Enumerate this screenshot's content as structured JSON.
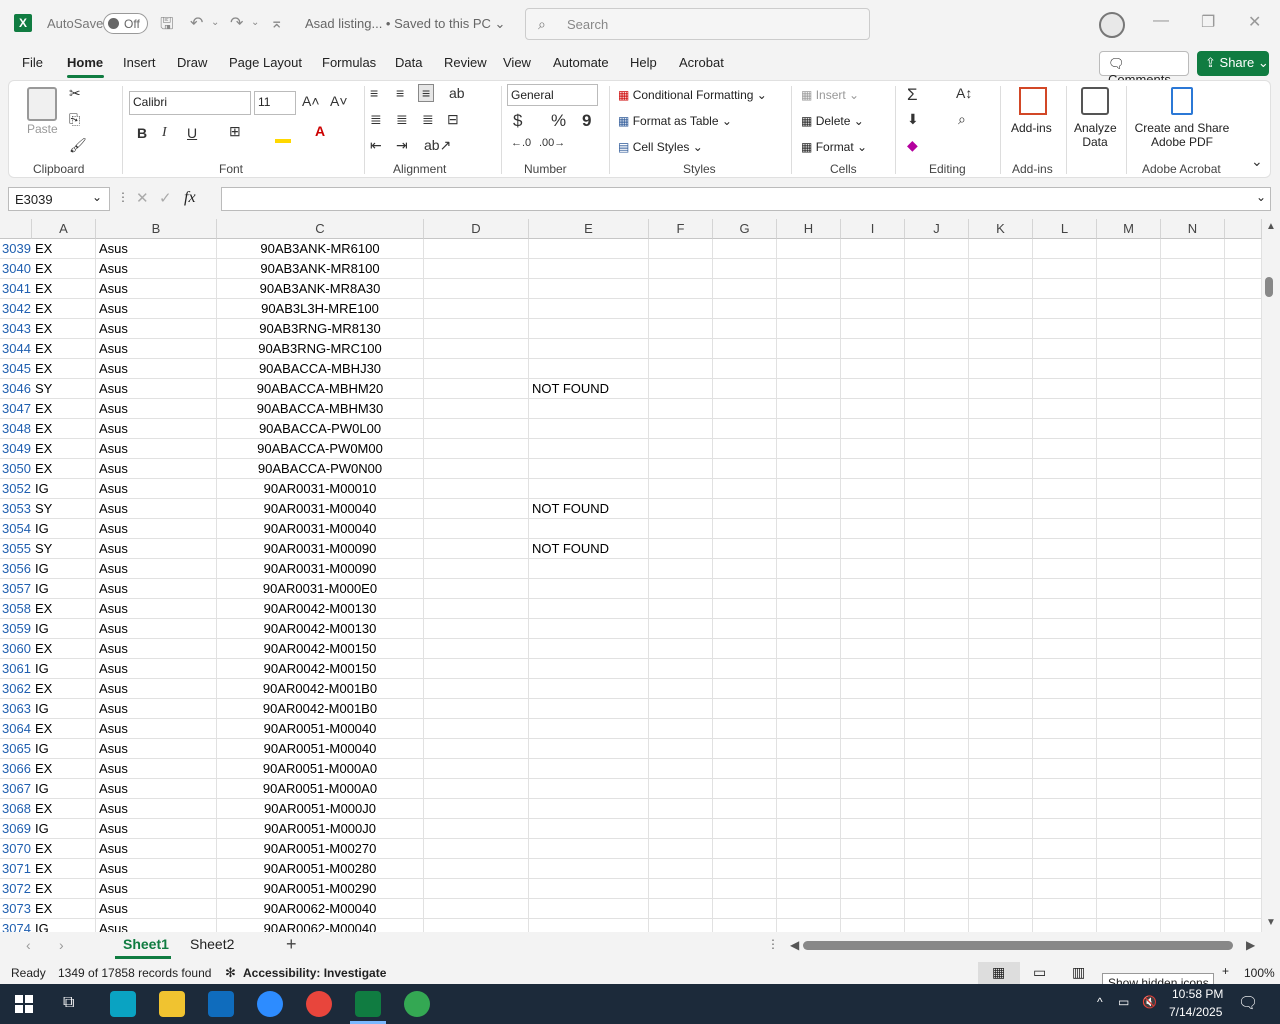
{
  "titlebar": {
    "autosave_label": "AutoSave",
    "autosave_state": "Off",
    "doc_title": "Asad listing...  •  Saved to this PC ⌄",
    "search_placeholder": "Search"
  },
  "menu": {
    "items": [
      "File",
      "Home",
      "Insert",
      "Draw",
      "Page Layout",
      "Formulas",
      "Data",
      "Review",
      "View",
      "Automate",
      "Help",
      "Acrobat"
    ],
    "active": "Home",
    "comments": "Comments",
    "share": "Share"
  },
  "ribbon": {
    "clipboard": {
      "paste": "Paste",
      "label": "Clipboard"
    },
    "font": {
      "name": "Calibri",
      "size": "11",
      "label": "Font",
      "bold": "B",
      "italic": "I",
      "underline": "U"
    },
    "alignment": {
      "label": "Alignment"
    },
    "number": {
      "format": "General",
      "label": "Number",
      "currency": "$",
      "percent": "%",
      "comma": "9"
    },
    "styles": {
      "conditional": "Conditional Formatting",
      "format_table": "Format as Table",
      "cell_styles": "Cell Styles",
      "label": "Styles"
    },
    "cells": {
      "insert": "Insert",
      "delete": "Delete",
      "format": "Format",
      "label": "Cells"
    },
    "editing": {
      "label": "Editing"
    },
    "addins": {
      "button": "Add-ins",
      "label": "Add-ins"
    },
    "analyze": {
      "line1": "Analyze",
      "line2": "Data"
    },
    "acrobat": {
      "line1": "Create and Share",
      "line2": "Adobe PDF",
      "label": "Adobe Acrobat"
    }
  },
  "formula_bar": {
    "namebox": "E3039",
    "fx": "fx",
    "value": ""
  },
  "columns": [
    "A",
    "B",
    "C",
    "D",
    "E",
    "F",
    "G",
    "H",
    "I",
    "J",
    "K",
    "L",
    "M",
    "N"
  ],
  "rows": [
    {
      "n": "3039",
      "a": "EX",
      "b": "Asus",
      "c": "90AB3ANK-MR6100",
      "e": ""
    },
    {
      "n": "3040",
      "a": "EX",
      "b": "Asus",
      "c": "90AB3ANK-MR8100",
      "e": ""
    },
    {
      "n": "3041",
      "a": "EX",
      "b": "Asus",
      "c": "90AB3ANK-MR8A30",
      "e": ""
    },
    {
      "n": "3042",
      "a": "EX",
      "b": "Asus",
      "c": "90AB3L3H-MRE100",
      "e": ""
    },
    {
      "n": "3043",
      "a": "EX",
      "b": "Asus",
      "c": "90AB3RNG-MR8130",
      "e": ""
    },
    {
      "n": "3044",
      "a": "EX",
      "b": "Asus",
      "c": "90AB3RNG-MRC100",
      "e": ""
    },
    {
      "n": "3045",
      "a": "EX",
      "b": "Asus",
      "c": "90ABACCA-MBHJ30",
      "e": ""
    },
    {
      "n": "3046",
      "a": "SY",
      "b": "Asus",
      "c": "90ABACCA-MBHM20",
      "e": "NOT FOUND"
    },
    {
      "n": "3047",
      "a": "EX",
      "b": "Asus",
      "c": "90ABACCA-MBHM30",
      "e": ""
    },
    {
      "n": "3048",
      "a": "EX",
      "b": "Asus",
      "c": "90ABACCA-PW0L00",
      "e": ""
    },
    {
      "n": "3049",
      "a": "EX",
      "b": "Asus",
      "c": "90ABACCA-PW0M00",
      "e": ""
    },
    {
      "n": "3050",
      "a": "EX",
      "b": "Asus",
      "c": "90ABACCA-PW0N00",
      "e": ""
    },
    {
      "n": "3052",
      "a": "IG",
      "b": "Asus",
      "c": "90AR0031-M00010",
      "e": ""
    },
    {
      "n": "3053",
      "a": "SY",
      "b": "Asus",
      "c": "90AR0031-M00040",
      "e": "NOT FOUND"
    },
    {
      "n": "3054",
      "a": "IG",
      "b": "Asus",
      "c": "90AR0031-M00040",
      "e": ""
    },
    {
      "n": "3055",
      "a": "SY",
      "b": "Asus",
      "c": "90AR0031-M00090",
      "e": "NOT FOUND"
    },
    {
      "n": "3056",
      "a": "IG",
      "b": "Asus",
      "c": "90AR0031-M00090",
      "e": ""
    },
    {
      "n": "3057",
      "a": "IG",
      "b": "Asus",
      "c": "90AR0031-M000E0",
      "e": ""
    },
    {
      "n": "3058",
      "a": "EX",
      "b": "Asus",
      "c": "90AR0042-M00130",
      "e": ""
    },
    {
      "n": "3059",
      "a": "IG",
      "b": "Asus",
      "c": "90AR0042-M00130",
      "e": ""
    },
    {
      "n": "3060",
      "a": "EX",
      "b": "Asus",
      "c": "90AR0042-M00150",
      "e": ""
    },
    {
      "n": "3061",
      "a": "IG",
      "b": "Asus",
      "c": "90AR0042-M00150",
      "e": ""
    },
    {
      "n": "3062",
      "a": "EX",
      "b": "Asus",
      "c": "90AR0042-M001B0",
      "e": ""
    },
    {
      "n": "3063",
      "a": "IG",
      "b": "Asus",
      "c": "90AR0042-M001B0",
      "e": ""
    },
    {
      "n": "3064",
      "a": "EX",
      "b": "Asus",
      "c": "90AR0051-M00040",
      "e": ""
    },
    {
      "n": "3065",
      "a": "IG",
      "b": "Asus",
      "c": "90AR0051-M00040",
      "e": ""
    },
    {
      "n": "3066",
      "a": "EX",
      "b": "Asus",
      "c": "90AR0051-M000A0",
      "e": ""
    },
    {
      "n": "3067",
      "a": "IG",
      "b": "Asus",
      "c": "90AR0051-M000A0",
      "e": ""
    },
    {
      "n": "3068",
      "a": "EX",
      "b": "Asus",
      "c": "90AR0051-M000J0",
      "e": ""
    },
    {
      "n": "3069",
      "a": "IG",
      "b": "Asus",
      "c": "90AR0051-M000J0",
      "e": ""
    },
    {
      "n": "3070",
      "a": "EX",
      "b": "Asus",
      "c": "90AR0051-M00270",
      "e": ""
    },
    {
      "n": "3071",
      "a": "EX",
      "b": "Asus",
      "c": "90AR0051-M00280",
      "e": ""
    },
    {
      "n": "3072",
      "a": "EX",
      "b": "Asus",
      "c": "90AR0051-M00290",
      "e": ""
    },
    {
      "n": "3073",
      "a": "EX",
      "b": "Asus",
      "c": "90AR0062-M00040",
      "e": ""
    },
    {
      "n": "3074",
      "a": "IG",
      "b": "Asus",
      "c": "90AR0062-M00040",
      "e": ""
    }
  ],
  "sheets": [
    "Sheet1",
    "Sheet2"
  ],
  "active_sheet": "Sheet1",
  "status": {
    "ready": "Ready",
    "records": "1349 of 17858 records found",
    "accessibility": "Accessibility: Investigate",
    "zoom": "100%"
  },
  "taskbar": {
    "time": "10:58 PM",
    "date": "7/14/2025",
    "tooltip": "Show hidden icons"
  },
  "colors": {
    "accent": "#107c41",
    "row_number": "#1f5fb0"
  }
}
